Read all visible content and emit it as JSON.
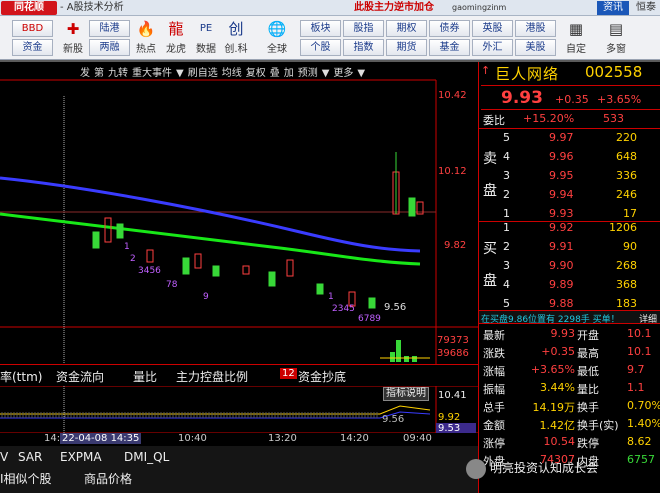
{
  "titlebar": {
    "logo": "同花顺",
    "title": "- A股技术分析",
    "message": "此股主力逆市加仓",
    "user": "gaomingzinm",
    "btn_info": "资讯",
    "btn_right": "恒泰"
  },
  "toolbar": {
    "left_buttons": [
      "BBD",
      "资金"
    ],
    "icons": [
      {
        "icon": "new-icon",
        "glyph": "✚",
        "label": "新股"
      },
      {
        "icon": "hot-icon",
        "glyph": "🔥",
        "label": "热点"
      },
      {
        "icon": "dragon-icon",
        "glyph": "龍",
        "label": "龙虎"
      },
      {
        "icon": "pe-icon",
        "glyph": "PE",
        "label": "数据"
      },
      {
        "icon": "growth-icon",
        "glyph": "创",
        "label": "创.科"
      },
      {
        "icon": "globe-icon",
        "glyph": "🌐",
        "label": "全球"
      }
    ],
    "grid_left": [
      "陆港",
      "两融"
    ],
    "grid": [
      [
        "板块",
        "股指",
        "期权",
        "债券",
        "英股",
        "港股"
      ],
      [
        "个股",
        "指数",
        "期货",
        "基金",
        "外汇",
        "美股"
      ]
    ],
    "right_icons": [
      {
        "icon": "custom-icon",
        "label": "自定"
      },
      {
        "icon": "more-icon",
        "label": "多窗"
      }
    ]
  },
  "chart": {
    "menu": [
      "发",
      "第",
      "九转",
      "重大事件",
      "▼",
      "刷自选",
      "均线",
      "复权",
      "叠",
      "加",
      "预测",
      "▼",
      "更多",
      "▼"
    ],
    "price_labels": [
      "10.42",
      "10.12",
      "9.82",
      "9.56"
    ],
    "vol_labels": [
      "79373",
      "39686"
    ],
    "tabs": [
      "率(ttm)",
      "资金流向",
      "量比",
      "主力控盘比例",
      "12",
      "资金抄底"
    ],
    "indicator_btn": "指标说明",
    "ind_labels": [
      "10.41",
      "9.92",
      "9.53",
      "9.56"
    ],
    "time_labels": [
      "14:2",
      "22-04-08 14:35",
      "10:40",
      "13:20",
      "14:20",
      "09:40"
    ],
    "digits": [
      "1",
      "2",
      "3456",
      "78",
      "9",
      "1",
      "2345",
      "6789",
      "9.56"
    ],
    "bottom_row1": [
      "V",
      "SAR",
      "EXPMA",
      "DMI_QL"
    ],
    "bottom_row2": [
      "I相似个股",
      "商品价格"
    ]
  },
  "quote": {
    "name": "巨人网络",
    "code": "002558",
    "price": "9.93",
    "change": "+0.35",
    "pct": "+3.65%",
    "weibi_label": "委比",
    "weibi": "+15.20%",
    "weicha": "533",
    "sell_label": [
      "卖",
      "盘"
    ],
    "buy_label": [
      "买",
      "盘"
    ],
    "sells": [
      {
        "lvl": "5",
        "p": "9.97",
        "v": "220"
      },
      {
        "lvl": "4",
        "p": "9.96",
        "v": "648"
      },
      {
        "lvl": "3",
        "p": "9.95",
        "v": "336"
      },
      {
        "lvl": "2",
        "p": "9.94",
        "v": "246"
      },
      {
        "lvl": "1",
        "p": "9.93",
        "v": "17"
      }
    ],
    "buys": [
      {
        "lvl": "1",
        "p": "9.92",
        "v": "1206"
      },
      {
        "lvl": "2",
        "p": "9.91",
        "v": "90"
      },
      {
        "lvl": "3",
        "p": "9.90",
        "v": "268"
      },
      {
        "lvl": "4",
        "p": "9.89",
        "v": "368"
      },
      {
        "lvl": "5",
        "p": "9.88",
        "v": "183"
      }
    ],
    "notice": "在买盘9.86位置有 2298手 买单！",
    "notice_tail": "详细",
    "stats": [
      {
        "k": "最新",
        "v": "9.93",
        "k2": "开盘",
        "v2": "10.1"
      },
      {
        "k": "涨跌",
        "v": "+0.35",
        "k2": "最高",
        "v2": "10.1"
      },
      {
        "k": "涨幅",
        "v": "+3.65%",
        "k2": "最低",
        "v2": "9.7"
      },
      {
        "k": "振幅",
        "v": "3.44%",
        "k2": "量比",
        "v2": "1.1"
      },
      {
        "k": "总手",
        "v": "14.19万",
        "k2": "换手",
        "v2": "0.70%"
      },
      {
        "k": "金额",
        "v": "1.42亿",
        "k2": "换手(实)",
        "v2": "1.40%"
      },
      {
        "k": "涨停",
        "v": "10.54",
        "k2": "跌停",
        "v2": "8.62"
      },
      {
        "k": "外盘",
        "v": "74307",
        "k2": "内盘",
        "v2": "6757"
      }
    ]
  },
  "watermark": "明亮投资认知成长会",
  "colors": {
    "up": "#ff4040",
    "down": "#38d838",
    "ma_blue": "#3a3cff",
    "ma_green": "#18e818",
    "bg": "#000000"
  }
}
